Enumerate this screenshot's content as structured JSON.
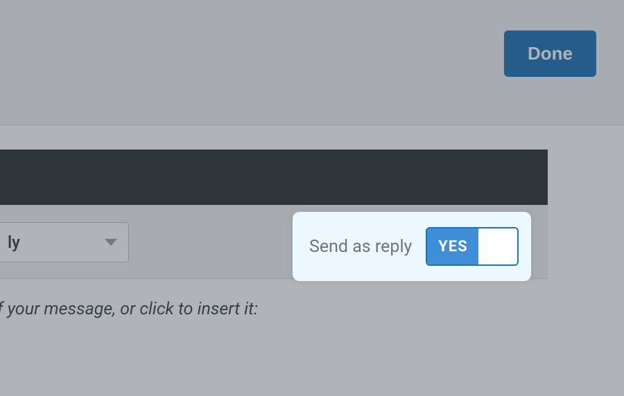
{
  "header": {
    "done_label": "Done"
  },
  "panel": {
    "dark_header_title": ""
  },
  "dropdown": {
    "visible_text": "ly"
  },
  "callout": {
    "label": "Send as reply",
    "toggle_label": "YES",
    "toggle_state": true
  },
  "hint": {
    "text": "f your message, or click to insert it:"
  },
  "colors": {
    "primary": "#1f73b7",
    "toggle_bg": "#3e8ed8",
    "callout_bg": "#edf7ff",
    "dim": "rgba(47,57,65,0.38)"
  }
}
